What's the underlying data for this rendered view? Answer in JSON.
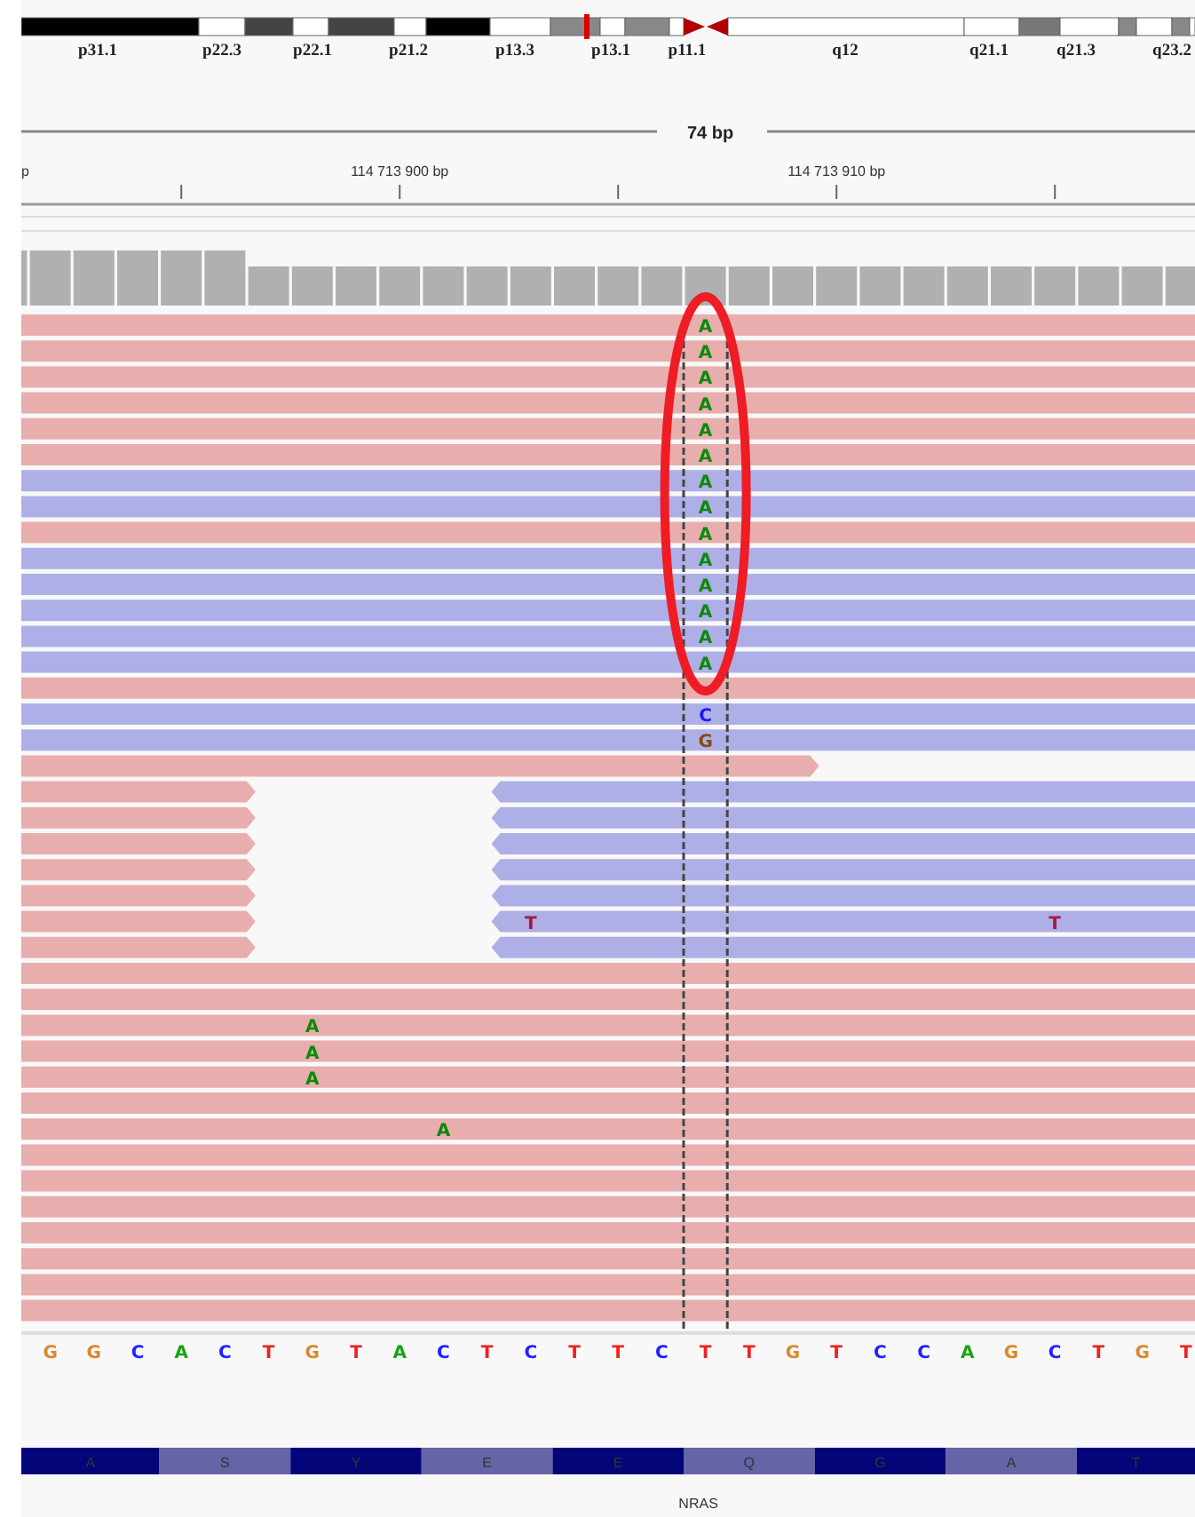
{
  "ideogram": {
    "band_labels": [
      "p31.1",
      "p22.3",
      "p22.1",
      "p21.2",
      "p13.3",
      "p13.1",
      "p11.1",
      "q12",
      "q21.1",
      "q21.3",
      "q23.2"
    ]
  },
  "ruler": {
    "span": "74 bp",
    "left_label": "p",
    "ticks": [
      "114 713 900 bp",
      "114 713 910 bp"
    ]
  },
  "reads": [
    {
      "kind": "forward",
      "mismatches": [
        {
          "base": "A"
        }
      ]
    },
    {
      "kind": "forward",
      "mismatches": [
        {
          "base": "A"
        }
      ]
    },
    {
      "kind": "forward",
      "mismatches": [
        {
          "base": "A"
        }
      ]
    },
    {
      "kind": "forward",
      "mismatches": [
        {
          "base": "A"
        }
      ]
    },
    {
      "kind": "forward",
      "mismatches": [
        {
          "base": "A"
        }
      ]
    },
    {
      "kind": "forward",
      "mismatches": [
        {
          "base": "A"
        }
      ]
    },
    {
      "kind": "reverse",
      "mismatches": [
        {
          "base": "A"
        }
      ]
    },
    {
      "kind": "reverse",
      "mismatches": [
        {
          "base": "A"
        }
      ]
    },
    {
      "kind": "forward",
      "mismatches": [
        {
          "base": "A"
        }
      ]
    },
    {
      "kind": "reverse",
      "mismatches": [
        {
          "base": "A"
        }
      ]
    },
    {
      "kind": "reverse",
      "mismatches": [
        {
          "base": "A"
        }
      ]
    },
    {
      "kind": "reverse",
      "mismatches": [
        {
          "base": "A"
        }
      ]
    },
    {
      "kind": "reverse",
      "mismatches": [
        {
          "base": "A"
        }
      ]
    },
    {
      "kind": "reverse",
      "mismatches": [
        {
          "base": "A"
        }
      ]
    },
    {
      "kind": "forward"
    },
    {
      "kind": "reverse",
      "mismatches": [
        {
          "base": "C"
        }
      ]
    },
    {
      "kind": "reverse",
      "mismatches": [
        {
          "base": "G"
        }
      ]
    },
    {
      "kind": "forward_short"
    },
    {
      "kind": "pair"
    },
    {
      "kind": "pair"
    },
    {
      "kind": "pair"
    },
    {
      "kind": "pair"
    },
    {
      "kind": "pair"
    },
    {
      "kind": "pair",
      "mismatches": [
        {
          "base": "T"
        },
        {
          "base": "T"
        }
      ]
    },
    {
      "kind": "pair"
    },
    {
      "kind": "forward"
    },
    {
      "kind": "forward"
    },
    {
      "kind": "forward",
      "mismatches": [
        {
          "base": "A"
        }
      ]
    },
    {
      "kind": "forward",
      "mismatches": [
        {
          "base": "A"
        }
      ]
    },
    {
      "kind": "forward",
      "mismatches": [
        {
          "base": "A"
        }
      ]
    },
    {
      "kind": "forward"
    },
    {
      "kind": "forward",
      "mismatches": [
        {
          "base": "A"
        }
      ]
    },
    {
      "kind": "forward"
    },
    {
      "kind": "forward"
    },
    {
      "kind": "forward"
    },
    {
      "kind": "forward"
    },
    {
      "kind": "forward"
    },
    {
      "kind": "forward"
    },
    {
      "kind": "forward"
    }
  ],
  "annotation": {
    "kind": "ellipse"
  },
  "center_guides": true,
  "sequence": [
    "G",
    "G",
    "C",
    "A",
    "C",
    "T",
    "G",
    "T",
    "A",
    "C",
    "T",
    "C",
    "T",
    "T",
    "C",
    "T",
    "T",
    "G",
    "T",
    "C",
    "C",
    "A",
    "G",
    "C",
    "T",
    "G",
    "T"
  ],
  "gene": {
    "name": "NRAS",
    "amino_acids": [
      "A",
      "S",
      "Y",
      "E",
      "E",
      "Q",
      "G",
      "A",
      "T"
    ]
  }
}
